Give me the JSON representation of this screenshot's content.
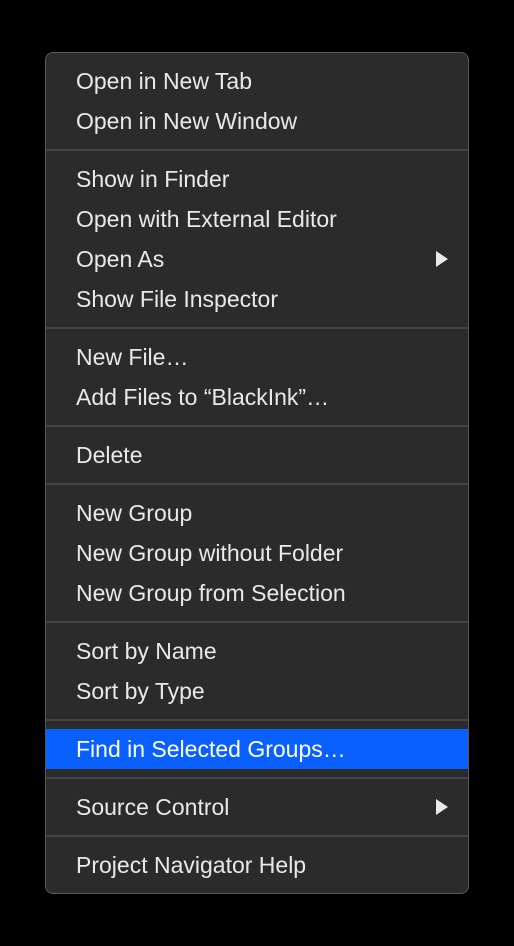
{
  "menu": {
    "groups": [
      {
        "items": [
          {
            "label": "Open in New Tab",
            "submenu": false,
            "highlighted": false
          },
          {
            "label": "Open in New Window",
            "submenu": false,
            "highlighted": false
          }
        ]
      },
      {
        "items": [
          {
            "label": "Show in Finder",
            "submenu": false,
            "highlighted": false
          },
          {
            "label": "Open with External Editor",
            "submenu": false,
            "highlighted": false
          },
          {
            "label": "Open As",
            "submenu": true,
            "highlighted": false
          },
          {
            "label": "Show File Inspector",
            "submenu": false,
            "highlighted": false
          }
        ]
      },
      {
        "items": [
          {
            "label": "New File…",
            "submenu": false,
            "highlighted": false
          },
          {
            "label": "Add Files to “BlackInk”…",
            "submenu": false,
            "highlighted": false
          }
        ]
      },
      {
        "items": [
          {
            "label": "Delete",
            "submenu": false,
            "highlighted": false
          }
        ]
      },
      {
        "items": [
          {
            "label": "New Group",
            "submenu": false,
            "highlighted": false
          },
          {
            "label": "New Group without Folder",
            "submenu": false,
            "highlighted": false
          },
          {
            "label": "New Group from Selection",
            "submenu": false,
            "highlighted": false
          }
        ]
      },
      {
        "items": [
          {
            "label": "Sort by Name",
            "submenu": false,
            "highlighted": false
          },
          {
            "label": "Sort by Type",
            "submenu": false,
            "highlighted": false
          }
        ]
      },
      {
        "items": [
          {
            "label": "Find in Selected Groups…",
            "submenu": false,
            "highlighted": true
          }
        ]
      },
      {
        "items": [
          {
            "label": "Source Control",
            "submenu": true,
            "highlighted": false
          }
        ]
      },
      {
        "items": [
          {
            "label": "Project Navigator Help",
            "submenu": false,
            "highlighted": false
          }
        ]
      }
    ]
  }
}
